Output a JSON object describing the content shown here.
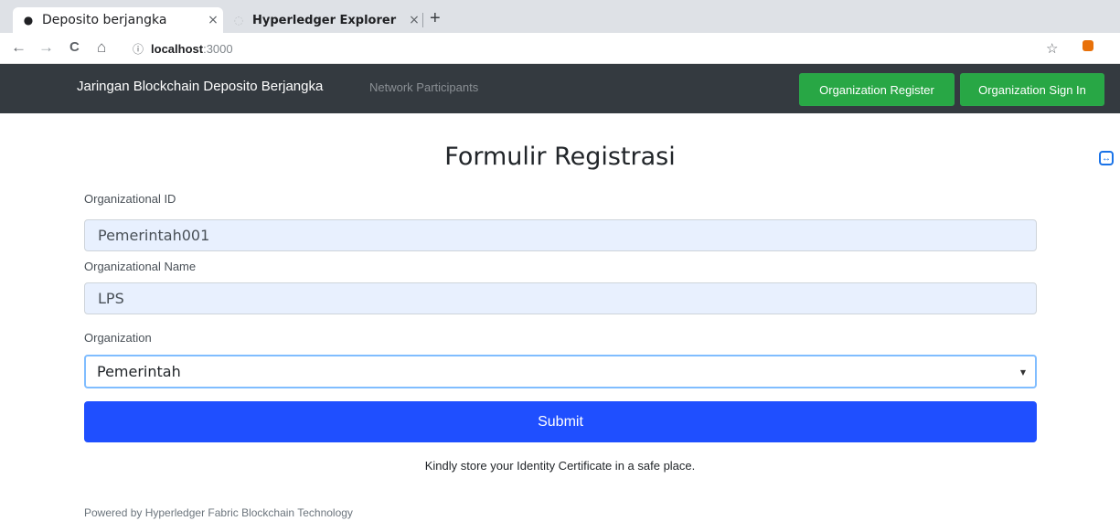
{
  "browser": {
    "tabs": [
      {
        "title": "Deposito berjangka",
        "close": "×",
        "icon": "globe-icon"
      },
      {
        "title": "Hyperledger Explorer",
        "close": "×",
        "icon": "page-icon"
      }
    ],
    "new_tab": "+",
    "url_host": "localhost",
    "url_port": ":3000",
    "nav": {
      "back": "←",
      "forward": "→",
      "reload": "C",
      "home": "⌂",
      "info": "ⓘ",
      "star": "☆"
    }
  },
  "navbar": {
    "brand": "Jaringan Blockchain Deposito Berjangka",
    "link": "Network Participants",
    "register_label": "Organization Register",
    "signin_label": "Organization Sign In"
  },
  "form": {
    "title": "Formulir Registrasi",
    "org_id_label": "Organizational ID",
    "org_id_value": "Pemerintah001",
    "org_name_label": "Organizational Name",
    "org_name_value": "LPS",
    "org_label": "Organization",
    "org_selected": "Pemerintah",
    "submit_label": "Submit",
    "note": "Kindly store your Identity Certificate in a safe place."
  },
  "footer": "Powered by Hyperledger Fabric Blockchain Technology",
  "colors": {
    "navbar": "#343a40",
    "green": "#28a745",
    "submit": "#1f4fff",
    "field": "#e8f0fe"
  }
}
